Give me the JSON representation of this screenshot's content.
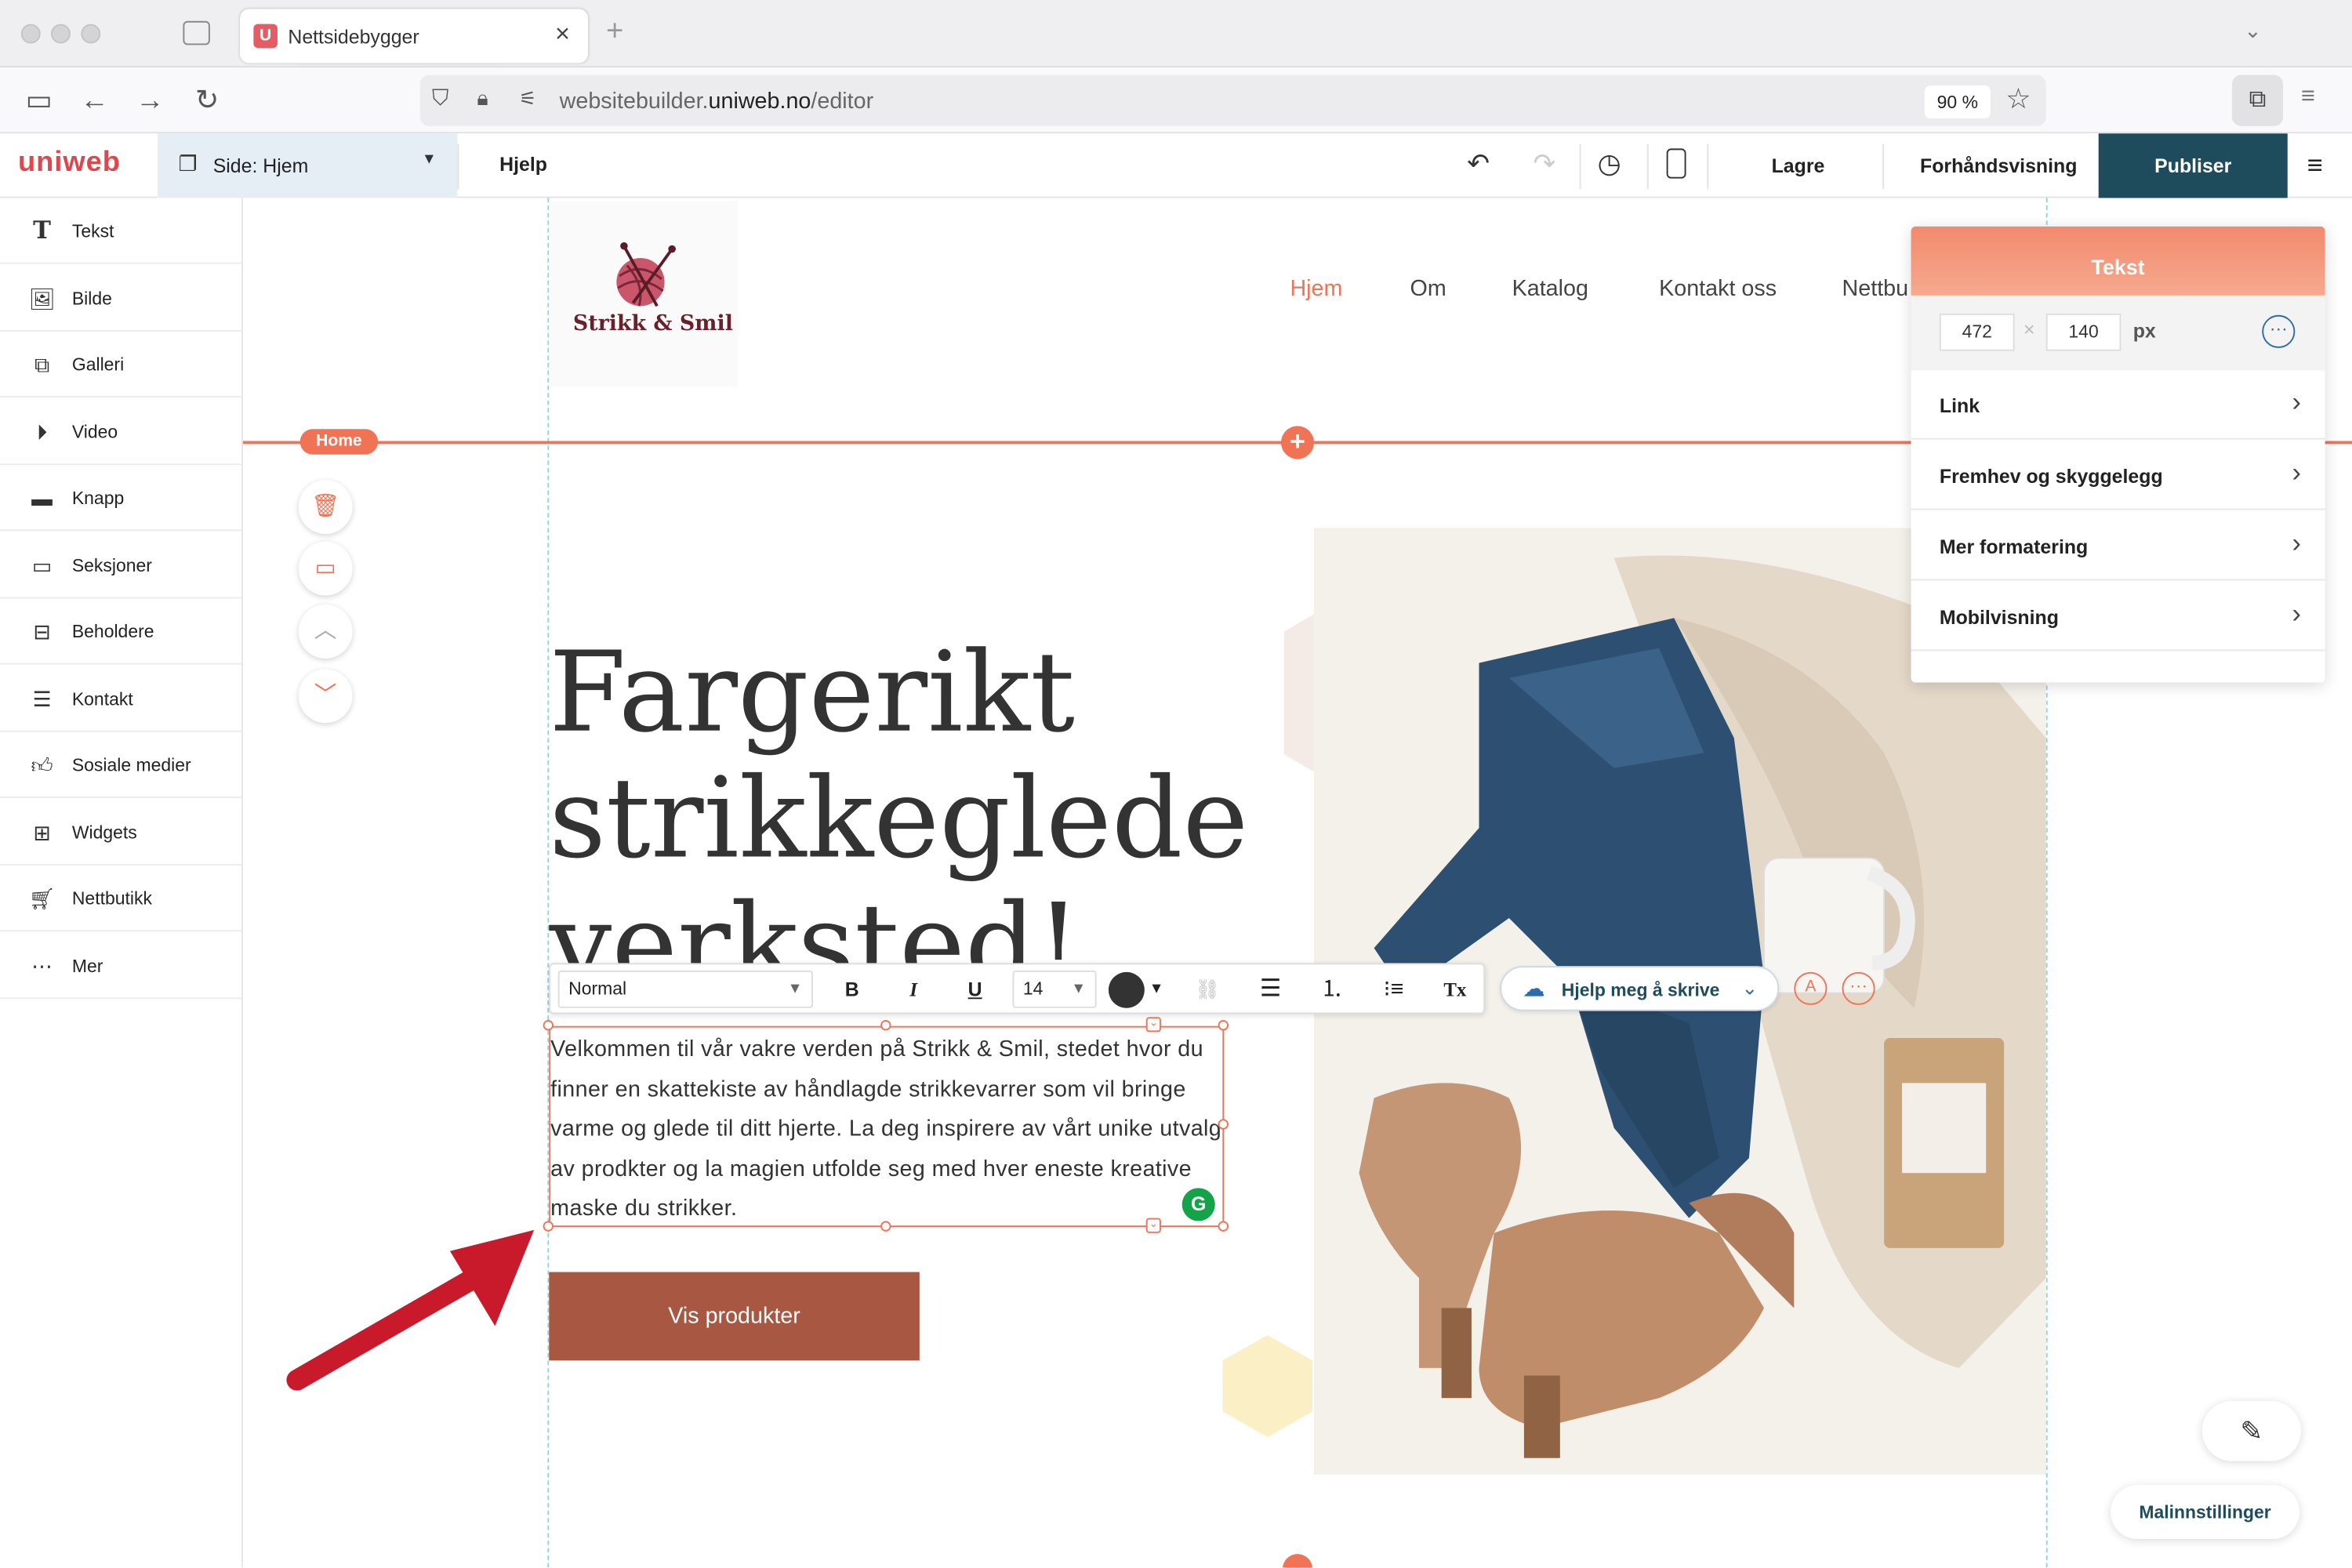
{
  "browser": {
    "tab_title": "Nettsidebygger",
    "tab_favicon": "U",
    "url_prefix": "websitebuilder.",
    "url_domain": "uniweb.no",
    "url_path": "/editor",
    "zoom": "90 %"
  },
  "app": {
    "logo": "uniweb",
    "page_selector": "Side: Hjem",
    "help": "Hjelp",
    "save": "Lagre",
    "preview": "Forhåndsvisning",
    "publish": "Publiser"
  },
  "sidebar": {
    "items": [
      {
        "label": "Tekst",
        "icon": "text-icon"
      },
      {
        "label": "Bilde",
        "icon": "image-icon"
      },
      {
        "label": "Galleri",
        "icon": "gallery-icon"
      },
      {
        "label": "Video",
        "icon": "video-icon"
      },
      {
        "label": "Knapp",
        "icon": "button-icon"
      },
      {
        "label": "Seksjoner",
        "icon": "sections-icon"
      },
      {
        "label": "Beholdere",
        "icon": "containers-icon"
      },
      {
        "label": "Kontakt",
        "icon": "contact-icon"
      },
      {
        "label": "Sosiale medier",
        "icon": "thumbs-up-icon"
      },
      {
        "label": "Widgets",
        "icon": "widgets-icon"
      },
      {
        "label": "Nettbutikk",
        "icon": "cart-icon"
      },
      {
        "label": "Mer",
        "icon": "more-icon"
      }
    ]
  },
  "site": {
    "logo_text": "Strikk & Smil",
    "nav": [
      "Hjem",
      "Om",
      "Katalog",
      "Kontakt oss",
      "Nettbu"
    ],
    "section_badge": "Home",
    "hero_title": "Fargerikt strikkeglede verksted!",
    "body_text": "Velkommen til vår vakre verden på Strikk & Smil, stedet hvor du finner en skattekiste av håndlagde strikkevarrer som vil bringe varme og glede til ditt hjerte. La deg inspirere av vårt unike utvalg av prodkter og la magien utfolde seg med hver eneste kreative maske du strikker.",
    "cta": "Vis produkter"
  },
  "toolbar": {
    "style": "Normal",
    "font_size": "14",
    "bold": "B",
    "italic": "I",
    "underline": "U",
    "clear": "Tx",
    "help_write": "Hjelp meg å skrive"
  },
  "panel": {
    "title": "Tekst",
    "width": "472",
    "times": "×",
    "height": "140",
    "unit": "px",
    "rows": [
      "Link",
      "Fremhev og skyggelegg",
      "Mer formatering",
      "Mobilvisning"
    ]
  },
  "footer": {
    "template_settings": "Malinnstillinger"
  },
  "colors": {
    "accent": "#f07356",
    "publish_bg": "#1e4c5c",
    "cta_bg": "#a85842",
    "logo": "#e0474c"
  }
}
